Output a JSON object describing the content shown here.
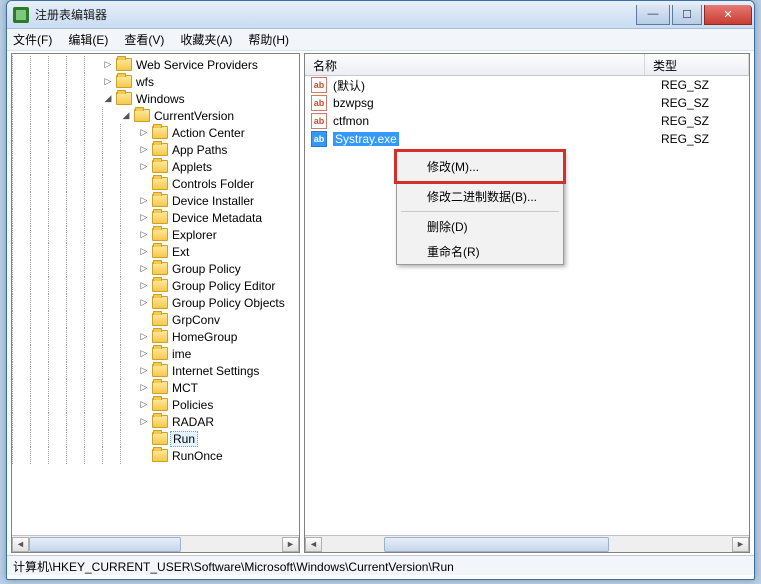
{
  "window": {
    "title": "注册表编辑器"
  },
  "menu": {
    "file": "文件(F)",
    "edit": "编辑(E)",
    "view": "查看(V)",
    "fav": "收藏夹(A)",
    "help": "帮助(H)"
  },
  "tree": [
    {
      "d": 5,
      "tw": "▷",
      "label": "Web Service Providers"
    },
    {
      "d": 5,
      "tw": "▷",
      "label": "wfs"
    },
    {
      "d": 5,
      "tw": "◢",
      "label": "Windows"
    },
    {
      "d": 6,
      "tw": "◢",
      "label": "CurrentVersion"
    },
    {
      "d": 7,
      "tw": "▷",
      "label": "Action Center"
    },
    {
      "d": 7,
      "tw": "▷",
      "label": "App Paths"
    },
    {
      "d": 7,
      "tw": "▷",
      "label": "Applets"
    },
    {
      "d": 7,
      "tw": "",
      "label": "Controls Folder"
    },
    {
      "d": 7,
      "tw": "▷",
      "label": "Device Installer"
    },
    {
      "d": 7,
      "tw": "▷",
      "label": "Device Metadata"
    },
    {
      "d": 7,
      "tw": "▷",
      "label": "Explorer"
    },
    {
      "d": 7,
      "tw": "▷",
      "label": "Ext"
    },
    {
      "d": 7,
      "tw": "▷",
      "label": "Group Policy"
    },
    {
      "d": 7,
      "tw": "▷",
      "label": "Group Policy Editor"
    },
    {
      "d": 7,
      "tw": "▷",
      "label": "Group Policy Objects"
    },
    {
      "d": 7,
      "tw": "",
      "label": "GrpConv"
    },
    {
      "d": 7,
      "tw": "▷",
      "label": "HomeGroup"
    },
    {
      "d": 7,
      "tw": "▷",
      "label": "ime"
    },
    {
      "d": 7,
      "tw": "▷",
      "label": "Internet Settings"
    },
    {
      "d": 7,
      "tw": "▷",
      "label": "MCT"
    },
    {
      "d": 7,
      "tw": "▷",
      "label": "Policies"
    },
    {
      "d": 7,
      "tw": "▷",
      "label": "RADAR"
    },
    {
      "d": 7,
      "tw": "",
      "label": "Run",
      "sel": true
    },
    {
      "d": 7,
      "tw": "",
      "label": "RunOnce"
    }
  ],
  "columns": {
    "name": "名称",
    "type": "类型"
  },
  "values": [
    {
      "name": "(默认)",
      "type": "REG_SZ"
    },
    {
      "name": "bzwpsg",
      "type": "REG_SZ"
    },
    {
      "name": "ctfmon",
      "type": "REG_SZ"
    },
    {
      "name": "Systray.exe",
      "type": "REG_SZ",
      "selected": true
    }
  ],
  "ctx": {
    "modify": "修改(M)...",
    "modifyBin": "修改二进制数据(B)...",
    "delete": "删除(D)",
    "rename": "重命名(R)"
  },
  "status": "计算机\\HKEY_CURRENT_USER\\Software\\Microsoft\\Windows\\CurrentVersion\\Run"
}
